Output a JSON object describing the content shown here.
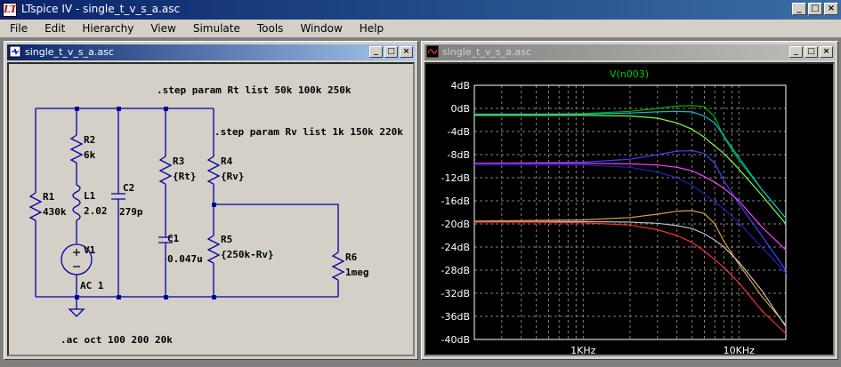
{
  "app": {
    "title": "LTspice IV - single_t_v_s_a.asc",
    "icon": "ltspice-logo-icon",
    "icon_text": "LT"
  },
  "window_buttons": {
    "minimize": "_",
    "maximize": "□",
    "close": "×"
  },
  "menu": [
    "File",
    "Edit",
    "Hierarchy",
    "View",
    "Simulate",
    "Tools",
    "Window",
    "Help"
  ],
  "schematic_window": {
    "title": "single_t_v_s_a.asc",
    "directives": [
      ".step param Rt list 50k 100k 250k",
      ".step param Rv list 1k 150k 220k",
      ".ac oct 100 200 20k"
    ],
    "components": [
      {
        "ref": "R1",
        "value": "430k"
      },
      {
        "ref": "R2",
        "value": "6k"
      },
      {
        "ref": "L1",
        "value": "2.02"
      },
      {
        "ref": "V1",
        "value": "AC 1"
      },
      {
        "ref": "C2",
        "value": "279p"
      },
      {
        "ref": "R3",
        "value": "{Rt}"
      },
      {
        "ref": "C1",
        "value": "0.047u"
      },
      {
        "ref": "R4",
        "value": "{Rv}"
      },
      {
        "ref": "R5",
        "value": "{250k-Rv}"
      },
      {
        "ref": "R6",
        "value": "1meg"
      }
    ]
  },
  "plot_window": {
    "title": "single_t_v_s_a.asc",
    "trace_label": "V(n003)",
    "colors": {
      "background": "#000000",
      "grid": "#808080",
      "axis_text": "#ffffff",
      "trace_label": "#00cc00"
    }
  },
  "chart_data": {
    "type": "line",
    "title": "V(n003)",
    "xscale": "log",
    "xlim": [
      200,
      20000
    ],
    "ylim": [
      -40,
      4
    ],
    "ytick_labels": [
      "4dB",
      "0dB",
      "-4dB",
      "-8dB",
      "-12dB",
      "-16dB",
      "-20dB",
      "-24dB",
      "-28dB",
      "-32dB",
      "-36dB",
      "-40dB"
    ],
    "xtick_labels": [
      {
        "value": 1000,
        "label": "1KHz"
      },
      {
        "value": 10000,
        "label": "10KHz"
      }
    ],
    "x": [
      200,
      500,
      1000,
      2000,
      3000,
      4000,
      5000,
      6000,
      7000,
      8000,
      10000,
      14000,
      20000
    ],
    "series": [
      {
        "color": "#00b000",
        "values": [
          -1.0,
          -1.0,
          -0.9,
          -0.5,
          0.0,
          0.4,
          0.5,
          0.3,
          -1.5,
          -5.0,
          -9.0,
          -14.0,
          -19.0
        ]
      },
      {
        "color": "#00c0d0",
        "values": [
          -1.0,
          -1.0,
          -1.0,
          -0.8,
          -0.6,
          -0.5,
          -0.6,
          -1.3,
          -2.5,
          -4.8,
          -8.5,
          -14.0,
          -19.0
        ]
      },
      {
        "color": "#80ff40",
        "values": [
          -1.2,
          -1.2,
          -1.2,
          -1.3,
          -1.7,
          -2.5,
          -3.6,
          -5.0,
          -6.5,
          -7.8,
          -10.5,
          -15.0,
          -20.0
        ]
      },
      {
        "color": "#4040ff",
        "values": [
          -9.5,
          -9.4,
          -9.3,
          -8.8,
          -8.0,
          -7.4,
          -7.3,
          -7.8,
          -9.5,
          -12.5,
          -16.5,
          -22.0,
          -28.0
        ]
      },
      {
        "color": "#ff40ff",
        "values": [
          -9.5,
          -9.5,
          -9.5,
          -9.6,
          -9.8,
          -10.2,
          -10.8,
          -11.8,
          -12.8,
          -13.8,
          -16.0,
          -20.5,
          -24.5
        ]
      },
      {
        "color": "#2020c0",
        "values": [
          -9.8,
          -9.8,
          -9.8,
          -10.2,
          -11.0,
          -12.0,
          -13.3,
          -14.8,
          -16.2,
          -17.4,
          -19.8,
          -24.0,
          -28.5
        ]
      },
      {
        "color": "#e0a040",
        "values": [
          -19.5,
          -19.4,
          -19.3,
          -18.9,
          -18.3,
          -17.8,
          -17.7,
          -18.2,
          -20.0,
          -23.0,
          -27.0,
          -32.5,
          -37.5
        ]
      },
      {
        "color": "#c0c0c0",
        "values": [
          -19.6,
          -19.6,
          -19.6,
          -19.7,
          -19.9,
          -20.3,
          -20.8,
          -21.7,
          -22.8,
          -24.0,
          -26.6,
          -31.5,
          -37.8
        ]
      },
      {
        "color": "#ff3030",
        "values": [
          -19.7,
          -19.7,
          -19.8,
          -20.2,
          -21.0,
          -22.0,
          -23.2,
          -24.7,
          -26.2,
          -27.5,
          -30.2,
          -35.0,
          -39.0
        ]
      }
    ]
  }
}
